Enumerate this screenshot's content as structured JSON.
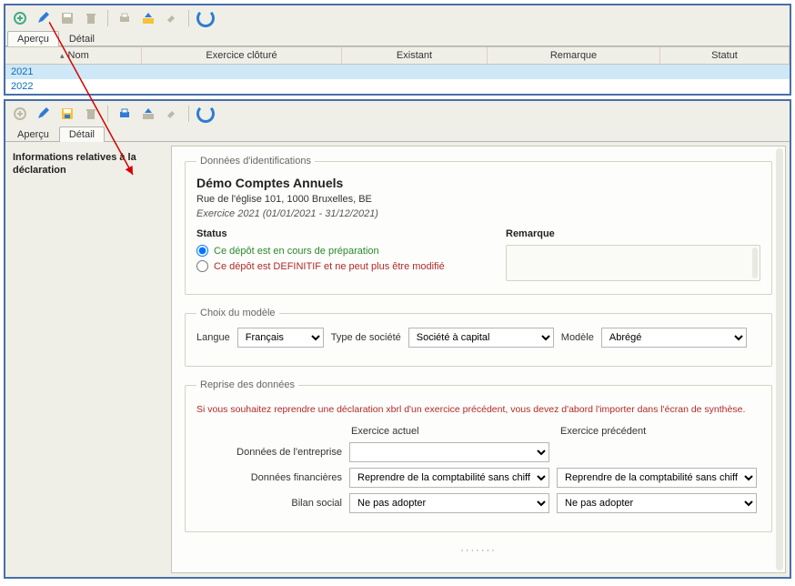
{
  "top": {
    "tabs": {
      "apercu": "Aperçu",
      "detail": "Détail"
    },
    "columns": {
      "nom": "Nom",
      "exercice": "Exercice clôturé",
      "existant": "Existant",
      "remarque": "Remarque",
      "statut": "Statut"
    },
    "rows": [
      {
        "year": "2021",
        "selected": true
      },
      {
        "year": "2022",
        "selected": false
      }
    ]
  },
  "bottom": {
    "tabs": {
      "apercu": "Aperçu",
      "detail": "Détail"
    },
    "side": {
      "item1": "Informations relatives à la déclaration"
    },
    "ident": {
      "legend": "Données d'identifications",
      "company": "Démo Comptes Annuels",
      "address": "Rue de l'église 101, 1000 Bruxelles, BE",
      "period": "Exercice 2021 (01/01/2021 - 31/12/2021)",
      "status_label": "Status",
      "status_opt1": "Ce dépôt est en cours de préparation",
      "status_opt2": "Ce dépôt est DEFINITIF et ne peut plus être modifié",
      "remark_label": "Remarque"
    },
    "model": {
      "legend": "Choix du modèle",
      "langue_label": "Langue",
      "langue_value": "Français",
      "type_label": "Type de société",
      "type_value": "Société à capital",
      "modele_label": "Modèle",
      "modele_value": "Abrégé"
    },
    "reprise": {
      "legend": "Reprise des données",
      "note": "Si vous souhaitez reprendre une déclaration xbrl d'un exercice précédent, vous devez d'abord l'importer dans l'écran de synthèse.",
      "col_actuel": "Exercice actuel",
      "col_precedent": "Exercice précédent",
      "row1": "Données de l'entreprise",
      "row1_actuel": "",
      "row2": "Données financières",
      "row2_val": "Reprendre de la comptabilité sans chiffre d'affai...",
      "row3": "Bilan social",
      "row3_val": "Ne pas adopter"
    }
  },
  "icons": {
    "add": "add-icon",
    "edit": "edit-icon",
    "save": "save-icon",
    "delete": "delete-icon",
    "print": "print-icon",
    "import": "import-icon",
    "export": "export-icon",
    "refresh": "refresh-icon"
  }
}
